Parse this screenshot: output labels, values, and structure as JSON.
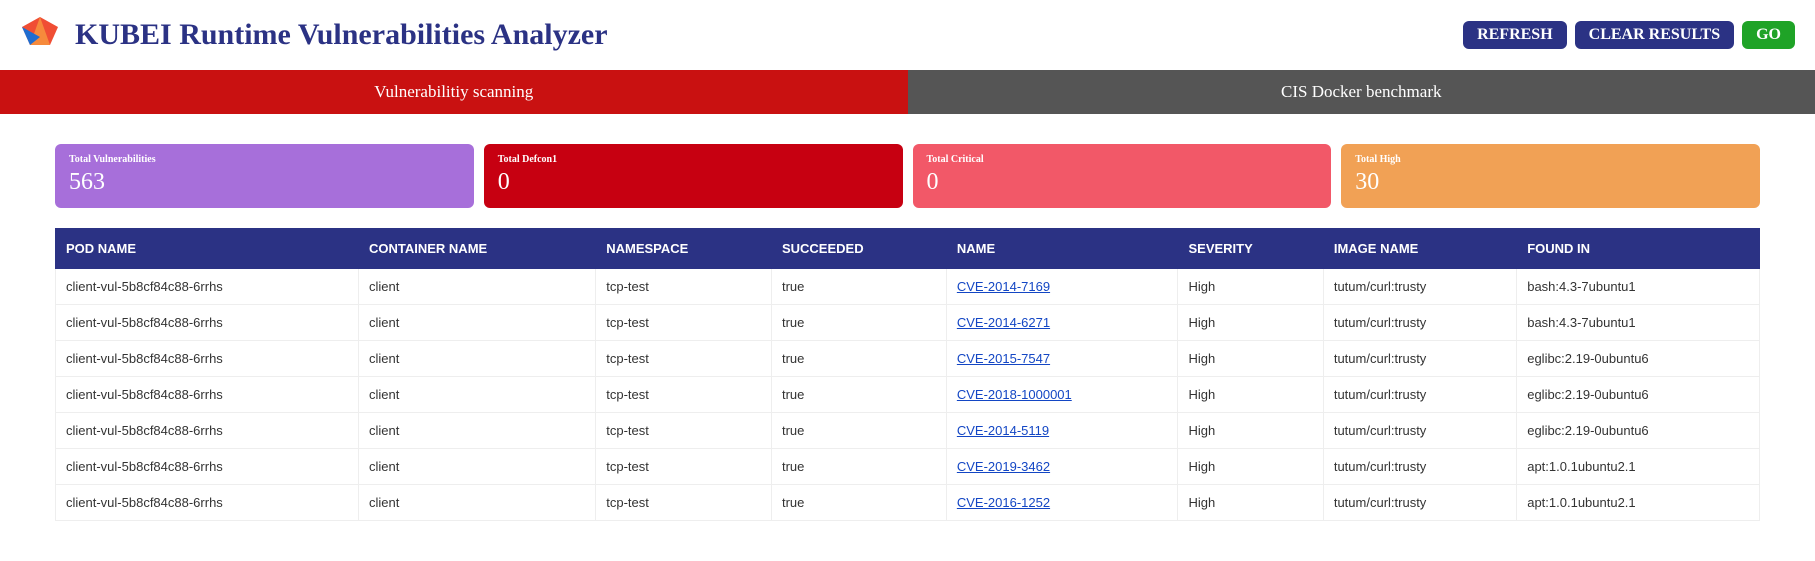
{
  "header": {
    "title": "KUBEI Runtime Vulnerabilities Analyzer",
    "refresh": "REFRESH",
    "clear": "CLEAR RESULTS",
    "go": "GO"
  },
  "tabs": {
    "active": "Vulnerabilitiy scanning",
    "inactive": "CIS Docker benchmark"
  },
  "stats": {
    "total_vuln": {
      "label": "Total Vulnerabilities",
      "value": "563"
    },
    "total_defcon1": {
      "label": "Total Defcon1",
      "value": "0"
    },
    "total_critical": {
      "label": "Total Critical",
      "value": "0"
    },
    "total_high": {
      "label": "Total High",
      "value": "30"
    }
  },
  "table": {
    "headers": {
      "pod": "POD NAME",
      "container": "CONTAINER NAME",
      "namespace": "NAMESPACE",
      "succeeded": "SUCCEEDED",
      "name": "NAME",
      "severity": "SEVERITY",
      "image": "IMAGE NAME",
      "found_in": "FOUND IN"
    },
    "rows": [
      {
        "pod": "client-vul-5b8cf84c88-6rrhs",
        "container": "client",
        "namespace": "tcp-test",
        "succeeded": "true",
        "name": "CVE-2014-7169",
        "severity": "High",
        "image": "tutum/curl:trusty",
        "found_in": "bash:4.3-7ubuntu1"
      },
      {
        "pod": "client-vul-5b8cf84c88-6rrhs",
        "container": "client",
        "namespace": "tcp-test",
        "succeeded": "true",
        "name": "CVE-2014-6271",
        "severity": "High",
        "image": "tutum/curl:trusty",
        "found_in": "bash:4.3-7ubuntu1"
      },
      {
        "pod": "client-vul-5b8cf84c88-6rrhs",
        "container": "client",
        "namespace": "tcp-test",
        "succeeded": "true",
        "name": "CVE-2015-7547",
        "severity": "High",
        "image": "tutum/curl:trusty",
        "found_in": "eglibc:2.19-0ubuntu6"
      },
      {
        "pod": "client-vul-5b8cf84c88-6rrhs",
        "container": "client",
        "namespace": "tcp-test",
        "succeeded": "true",
        "name": "CVE-2018-1000001",
        "severity": "High",
        "image": "tutum/curl:trusty",
        "found_in": "eglibc:2.19-0ubuntu6"
      },
      {
        "pod": "client-vul-5b8cf84c88-6rrhs",
        "container": "client",
        "namespace": "tcp-test",
        "succeeded": "true",
        "name": "CVE-2014-5119",
        "severity": "High",
        "image": "tutum/curl:trusty",
        "found_in": "eglibc:2.19-0ubuntu6"
      },
      {
        "pod": "client-vul-5b8cf84c88-6rrhs",
        "container": "client",
        "namespace": "tcp-test",
        "succeeded": "true",
        "name": "CVE-2019-3462",
        "severity": "High",
        "image": "tutum/curl:trusty",
        "found_in": "apt:1.0.1ubuntu2.1"
      },
      {
        "pod": "client-vul-5b8cf84c88-6rrhs",
        "container": "client",
        "namespace": "tcp-test",
        "succeeded": "true",
        "name": "CVE-2016-1252",
        "severity": "High",
        "image": "tutum/curl:trusty",
        "found_in": "apt:1.0.1ubuntu2.1"
      }
    ]
  }
}
